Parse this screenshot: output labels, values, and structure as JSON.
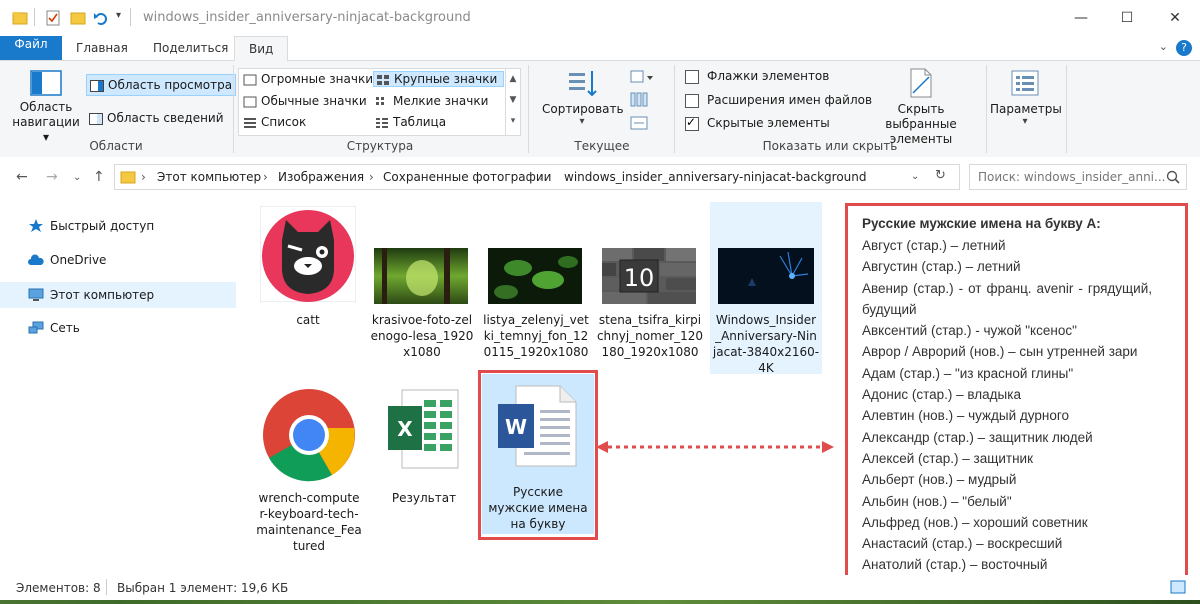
{
  "window": {
    "title": "windows_insider_anniversary-ninjacat-background",
    "controls": {
      "minimize": "—",
      "maximize": "☐",
      "close": "✕"
    }
  },
  "ribbon": {
    "tabs": [
      {
        "label": "Файл"
      },
      {
        "label": "Главная"
      },
      {
        "label": "Поделиться"
      },
      {
        "label": "Вид"
      }
    ],
    "panes": {
      "nav_pane_line1": "Область",
      "nav_pane_line2": "навигации",
      "preview_pane": "Область просмотра",
      "details_pane": "Область сведений",
      "group": "Области"
    },
    "layout": {
      "extra_large": "Огромные значки",
      "large": "Крупные значки",
      "medium": "Обычные значки",
      "small": "Мелкие значки",
      "list": "Список",
      "details": "Таблица",
      "group": "Структура"
    },
    "current_view": {
      "sort": "Сортировать",
      "group": "Текущее представление"
    },
    "show_hide": {
      "item_checkboxes": "Флажки элементов",
      "file_extensions": "Расширения имен файлов",
      "hidden_items": "Скрытые элементы",
      "hide_selected_line1": "Скрыть выбранные",
      "hide_selected_line2": "элементы",
      "group": "Показать или скрыть",
      "item_checkboxes_checked": false,
      "file_extensions_checked": false,
      "hidden_items_checked": true
    },
    "options": "Параметры"
  },
  "address": {
    "crumbs": [
      "Этот компьютер",
      "Изображения",
      "Сохраненные фотографии",
      "windows_insider_anniversary-ninjacat-background"
    ],
    "search_placeholder": "Поиск: windows_insider_anni..."
  },
  "nav": {
    "items": [
      {
        "label": "Быстрый доступ",
        "icon": "star-icon"
      },
      {
        "label": "OneDrive",
        "icon": "cloud-icon"
      },
      {
        "label": "Этот компьютер",
        "icon": "computer-icon"
      },
      {
        "label": "Сеть",
        "icon": "network-icon"
      }
    ]
  },
  "files": {
    "catt": "catt",
    "forest1": "krasivoe-foto-zel enogo-lesa_1920 x1080",
    "leaves": "listya_zelenyj_vet ki_temnyj_fon_12 0115_1920x1080",
    "stena": "stena_tsifra_kirpi chnyj_nomer_120 180_1920x1080",
    "insider": "Windows_Insider _Anniversary-Nin jacat-3840x2160- 4K",
    "wrench": "wrench-compute r-keyboard-tech- maintenance_Fea tured",
    "excel": "Результат",
    "word": "Русские мужские имена на букву",
    "stena_number": "10"
  },
  "status": {
    "count": "Элементов: 8",
    "selection": "Выбран 1 элемент: 19,6 КБ"
  },
  "names_panel": {
    "title": "Русские мужские имена на букву А:",
    "lines": [
      "Август (стар.) – летний",
      "Августин (стар.) – летний",
      "Авенир (стар.) - от франц. avenir - грядущий, будущий",
      "Авксентий (стар.) - чужой \"ксенос\"",
      "Аврор / Аврорий (нов.) – сын утренней зари",
      "Адам (стар.) – \"из красной глины\"",
      "Адонис (стар.) – владыка",
      "Алевтин (нов.) – чуждый дурного",
      "Александр (стар.) – защитник людей",
      "Алексей (стар.) – защитник",
      "Альберт (нов.) – мудрый",
      "Альбин (нов.) – \"белый\"",
      "Альфред (нов.) – хороший советник",
      "Анастасий (стар.) – воскресший",
      "Анатолий (стар.) – восточный"
    ]
  },
  "colors": {
    "accent": "#1979ca",
    "annotation_red": "#e04b4b",
    "selection": "#cce8ff"
  }
}
